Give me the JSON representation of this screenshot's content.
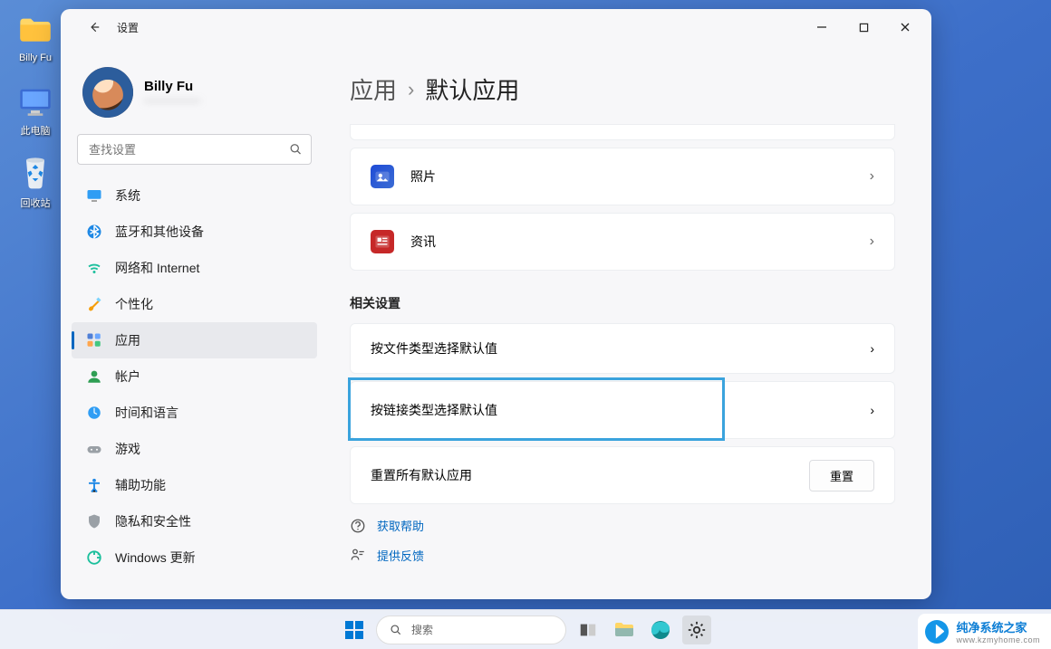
{
  "desktop": {
    "folder_label": "Billy Fu",
    "pc_label": "此电脑",
    "bin_label": "回收站"
  },
  "titlebar": {
    "title": "设置"
  },
  "profile": {
    "name": "Billy Fu",
    "sub": "────────"
  },
  "search": {
    "placeholder": "查找设置"
  },
  "nav": {
    "items": [
      {
        "label": "系统"
      },
      {
        "label": "蓝牙和其他设备"
      },
      {
        "label": "网络和 Internet"
      },
      {
        "label": "个性化"
      },
      {
        "label": "应用"
      },
      {
        "label": "帐户"
      },
      {
        "label": "时间和语言"
      },
      {
        "label": "游戏"
      },
      {
        "label": "辅助功能"
      },
      {
        "label": "隐私和安全性"
      },
      {
        "label": "Windows 更新"
      }
    ]
  },
  "crumbs": {
    "root": "应用",
    "current": "默认应用"
  },
  "apps": {
    "photos": "照片",
    "news": "资讯"
  },
  "related": {
    "heading": "相关设置",
    "by_filetype": "按文件类型选择默认值",
    "by_linktype": "按链接类型选择默认值",
    "reset_label": "重置所有默认应用",
    "reset_btn": "重置"
  },
  "links": {
    "help": "获取帮助",
    "feedback": "提供反馈"
  },
  "taskbar": {
    "search_hint": "搜索"
  },
  "watermark": {
    "text": "纯净系统之家",
    "url": "www.kzmyhome.com"
  }
}
